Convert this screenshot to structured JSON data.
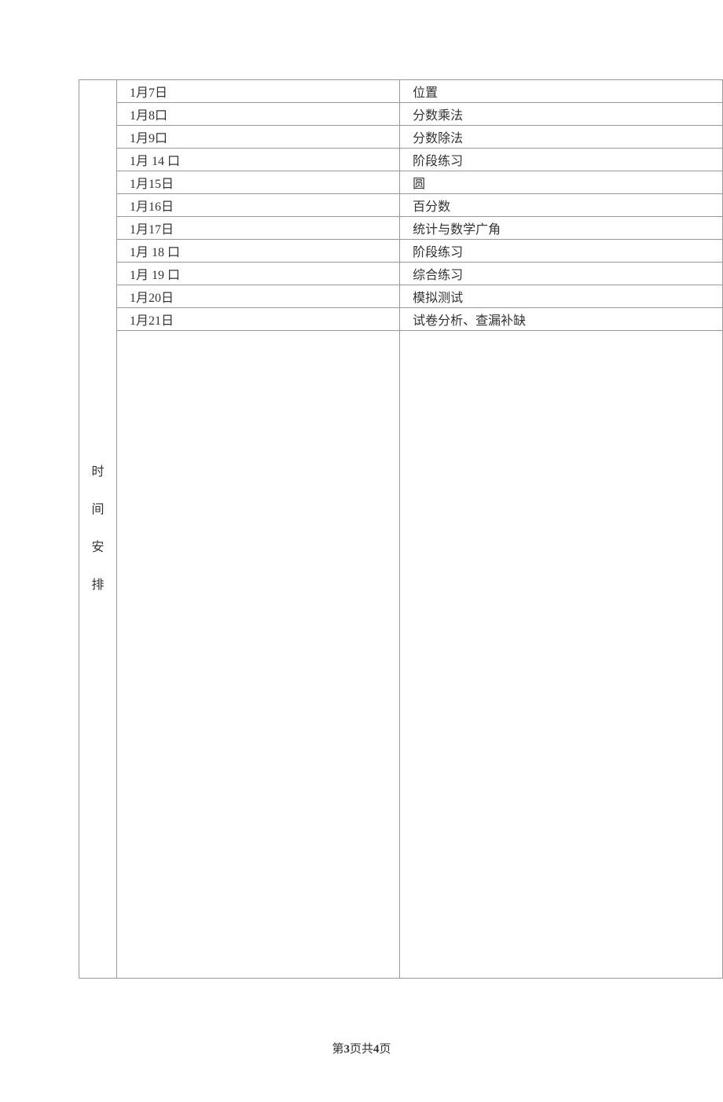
{
  "sidebar": {
    "label_line1": "时",
    "label_line2": "间",
    "label_line3": "安",
    "label_line4": "排"
  },
  "schedule": {
    "rows": [
      {
        "date": "1月7日",
        "content": "位置"
      },
      {
        "date": "1月8口",
        "content": "分数乘法"
      },
      {
        "date": "1月9口",
        "content": "分数除法"
      },
      {
        "date": "1月 14 口",
        "content": "阶段练习"
      },
      {
        "date": "1月15日",
        "content": "圆"
      },
      {
        "date": "1月16日",
        "content": "百分数"
      },
      {
        "date": "1月17日",
        "content": "统计与数学广角"
      },
      {
        "date": "1月 18 口",
        "content": "阶段练习"
      },
      {
        "date": "1月 19 口",
        "content": "综合练习"
      },
      {
        "date": "1月20日",
        "content": "模拟测试"
      },
      {
        "date": "1月21日",
        "content": "试卷分析、查漏补缺"
      }
    ]
  },
  "footer": {
    "prefix": "第",
    "current_page": "3",
    "middle": "页共",
    "total_pages": "4",
    "suffix": "页"
  }
}
